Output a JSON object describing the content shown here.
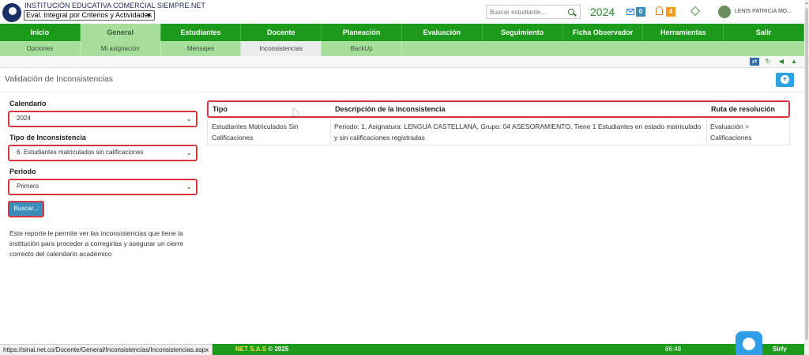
{
  "header": {
    "institution": "INSTITUCIÓN EDUCATIVA COMERCIAL SIEMPRE.NET",
    "eval_mode": "Eval. Integral por Criterios y Actividades",
    "search_placeholder": "Buscar estudiante...",
    "year": "2024",
    "messages_count": "0",
    "notifications_count": "4",
    "user_name": "LENIS PATRICIA MO..."
  },
  "nav": {
    "items": [
      "Inicio",
      "General",
      "Estudiantes",
      "Docente",
      "Planeación",
      "Evaluación",
      "Seguimiento",
      "Ficha Observador",
      "Herramientas",
      "Salir"
    ],
    "active": "General"
  },
  "subnav": {
    "items": [
      "Opciones",
      "Mi asignación",
      "Mensajes",
      "Inconsistencias",
      "BackUp"
    ],
    "active": "Inconsistencias"
  },
  "page": {
    "title": "Validación de Inconsistencias"
  },
  "form": {
    "calendar_label": "Calendario",
    "calendar_value": "2024",
    "type_label": "Tipo de Inconsistencia",
    "type_value": "6. Estudiantes matriculados sin calificaciones",
    "period_label": "Periodo",
    "period_value": "Primero",
    "search_button": "Buscar...",
    "help_text": "Este reporte le permite ver las inconsistencias que tiene la institución para proceder a corregirlas y asegurar un cierre correcto del calendario académico"
  },
  "table": {
    "headers": [
      "Tipo",
      "Descripción de la Inconsistencia",
      "Ruta de resolución"
    ],
    "rows": [
      {
        "tipo": "Estudiantes Matriculados Sin Calificaciones",
        "descripcion": "Periodo: 1, Asignatura: LENGUA CASTELLANA, Grupo: 04 ASESORAMIENTO, Tiene 1 Estudiantes en estado matriculado y sin calificaciones registradas",
        "ruta": "Evaluación > Calificaciones"
      }
    ]
  },
  "footer": {
    "brand": "NET S.A.S",
    "copyright": "© 2025",
    "time": "86:48",
    "sirfy": "Sirfy"
  },
  "status_url": "https://sinai.net.co/Docente/General/Inconsistencias/Inconsistencias.aspx",
  "colors": {
    "nav_green": "#1b9a1b",
    "subnav_green": "#a6df9c",
    "highlight_red": "#d6363d",
    "button_blue": "#3c8dbc"
  }
}
